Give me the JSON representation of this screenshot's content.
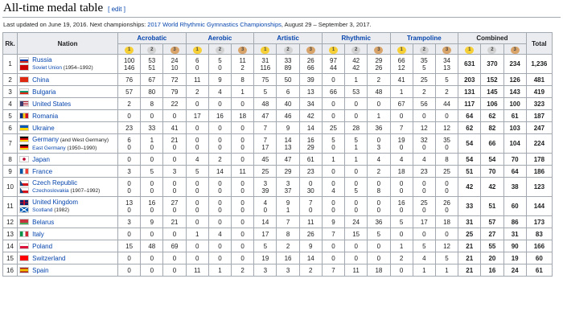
{
  "title": "All-time medal table",
  "edit": "[ edit ]",
  "updated": {
    "prefix": "Last updated on June 19, 2016. Next championships: ",
    "link": "2017 World Rhythmic Gymnastics Championships",
    "suffix": ", August 29 – September 3, 2017."
  },
  "headers": {
    "rk": "Rk.",
    "nation": "Nation",
    "sports": [
      "Acrobatic",
      "Aerobic",
      "Artistic",
      "Rhythmic",
      "Trampoline"
    ],
    "combined": "Combined",
    "total": "Total",
    "medals": [
      "1",
      "2",
      "3"
    ]
  },
  "rows": [
    {
      "rk": "1",
      "nations": [
        {
          "name": "Russia",
          "flag": "russia",
          "sub": false,
          "extra": ""
        },
        {
          "name": "Soviet Union",
          "flag": "ussr",
          "sub": true,
          "extra": " (1954–1992)"
        }
      ],
      "sports": [
        [
          "100",
          "146"
        ],
        [
          "53",
          "51"
        ],
        [
          "24",
          "10"
        ],
        [
          "6",
          "0"
        ],
        [
          "5",
          "0"
        ],
        [
          "11",
          "2"
        ],
        [
          "31",
          "116"
        ],
        [
          "33",
          "89"
        ],
        [
          "26",
          "66"
        ],
        [
          "97",
          "44"
        ],
        [
          "42",
          "42"
        ],
        [
          "29",
          "26"
        ],
        [
          "66",
          "12"
        ],
        [
          "35",
          "5"
        ],
        [
          "34",
          "13"
        ],
        [
          "9",
          "7"
        ]
      ],
      "combined": [
        "631",
        "370",
        "234"
      ],
      "total": "1,236"
    },
    {
      "rk": "2",
      "nations": [
        {
          "name": "China",
          "flag": "china",
          "sub": false,
          "extra": ""
        }
      ],
      "sports": [
        [
          "76"
        ],
        [
          "67"
        ],
        [
          "72"
        ],
        [
          "11"
        ],
        [
          "9"
        ],
        [
          "8"
        ],
        [
          "75"
        ],
        [
          "50"
        ],
        [
          "39"
        ],
        [
          "0"
        ],
        [
          "1"
        ],
        [
          "2"
        ],
        [
          "41"
        ],
        [
          "25"
        ],
        [
          "5"
        ]
      ],
      "combined": [
        "203",
        "152",
        "126"
      ],
      "total": "481"
    },
    {
      "rk": "3",
      "nations": [
        {
          "name": "Bulgaria",
          "flag": "bulgaria",
          "sub": false,
          "extra": ""
        }
      ],
      "sports": [
        [
          "57"
        ],
        [
          "80"
        ],
        [
          "79"
        ],
        [
          "2"
        ],
        [
          "4"
        ],
        [
          "1"
        ],
        [
          "5"
        ],
        [
          "6"
        ],
        [
          "13"
        ],
        [
          "66"
        ],
        [
          "53"
        ],
        [
          "48"
        ],
        [
          "1"
        ],
        [
          "2"
        ],
        [
          "2"
        ]
      ],
      "combined": [
        "131",
        "145",
        "143"
      ],
      "total": "419"
    },
    {
      "rk": "4",
      "nations": [
        {
          "name": "United States",
          "flag": "usa",
          "sub": false,
          "extra": ""
        }
      ],
      "sports": [
        [
          "2"
        ],
        [
          "8"
        ],
        [
          "22"
        ],
        [
          "0"
        ],
        [
          "0"
        ],
        [
          "0"
        ],
        [
          "48"
        ],
        [
          "40"
        ],
        [
          "34"
        ],
        [
          "0"
        ],
        [
          "0"
        ],
        [
          "0"
        ],
        [
          "67"
        ],
        [
          "56"
        ],
        [
          "44"
        ]
      ],
      "combined": [
        "117",
        "106",
        "100"
      ],
      "total": "323"
    },
    {
      "rk": "5",
      "nations": [
        {
          "name": "Romania",
          "flag": "romania",
          "sub": false,
          "extra": ""
        }
      ],
      "sports": [
        [
          "0"
        ],
        [
          "0"
        ],
        [
          "0"
        ],
        [
          "17"
        ],
        [
          "16"
        ],
        [
          "18"
        ],
        [
          "47"
        ],
        [
          "46"
        ],
        [
          "42"
        ],
        [
          "0"
        ],
        [
          "0"
        ],
        [
          "1"
        ],
        [
          "0"
        ],
        [
          "0"
        ],
        [
          "0"
        ]
      ],
      "combined": [
        "64",
        "62",
        "61"
      ],
      "total": "187"
    },
    {
      "rk": "6",
      "nations": [
        {
          "name": "Ukraine",
          "flag": "ukraine",
          "sub": false,
          "extra": ""
        }
      ],
      "sports": [
        [
          "23"
        ],
        [
          "33"
        ],
        [
          "41"
        ],
        [
          "0"
        ],
        [
          "0"
        ],
        [
          "0"
        ],
        [
          "7"
        ],
        [
          "9"
        ],
        [
          "14"
        ],
        [
          "25"
        ],
        [
          "28"
        ],
        [
          "36"
        ],
        [
          "7"
        ],
        [
          "12"
        ],
        [
          "12"
        ]
      ],
      "combined": [
        "62",
        "82",
        "103"
      ],
      "total": "247"
    },
    {
      "rk": "7",
      "nations": [
        {
          "name": "Germany",
          "flag": "germany",
          "sub": false,
          "extra": " (and West Germany)"
        },
        {
          "name": "East Germany",
          "flag": "gdr",
          "sub": true,
          "extra": " (1950–1990)"
        }
      ],
      "sports": [
        [
          "6",
          "0"
        ],
        [
          "1",
          "0"
        ],
        [
          "21",
          "0"
        ],
        [
          "0",
          "0"
        ],
        [
          "0",
          "0"
        ],
        [
          "0",
          "0"
        ],
        [
          "7",
          "17"
        ],
        [
          "14",
          "13"
        ],
        [
          "16",
          "29"
        ],
        [
          "5",
          "0"
        ],
        [
          "5",
          "1"
        ],
        [
          "0",
          "3"
        ],
        [
          "19",
          "0"
        ],
        [
          "32",
          "0"
        ],
        [
          "35",
          "0"
        ]
      ],
      "combined": [
        "54",
        "66",
        "104"
      ],
      "total": "224"
    },
    {
      "rk": "8",
      "nations": [
        {
          "name": "Japan",
          "flag": "japan",
          "sub": false,
          "extra": ""
        }
      ],
      "sports": [
        [
          "0"
        ],
        [
          "0"
        ],
        [
          "0"
        ],
        [
          "4"
        ],
        [
          "2"
        ],
        [
          "0"
        ],
        [
          "45"
        ],
        [
          "47"
        ],
        [
          "61"
        ],
        [
          "1"
        ],
        [
          "1"
        ],
        [
          "4"
        ],
        [
          "4"
        ],
        [
          "4"
        ],
        [
          "8"
        ]
      ],
      "combined": [
        "54",
        "54",
        "70"
      ],
      "total": "178"
    },
    {
      "rk": "9",
      "nations": [
        {
          "name": "France",
          "flag": "france",
          "sub": false,
          "extra": ""
        }
      ],
      "sports": [
        [
          "3"
        ],
        [
          "5"
        ],
        [
          "3"
        ],
        [
          "5"
        ],
        [
          "14"
        ],
        [
          "11"
        ],
        [
          "25"
        ],
        [
          "29"
        ],
        [
          "23"
        ],
        [
          "0"
        ],
        [
          "0"
        ],
        [
          "2"
        ],
        [
          "18"
        ],
        [
          "23"
        ],
        [
          "25"
        ]
      ],
      "combined": [
        "51",
        "70",
        "64"
      ],
      "total": "186"
    },
    {
      "rk": "10",
      "nations": [
        {
          "name": "Czech Republic",
          "flag": "czech",
          "sub": false,
          "extra": ""
        },
        {
          "name": "Czechoslovakia",
          "flag": "czech",
          "sub": true,
          "extra": " (1907–1992)"
        }
      ],
      "sports": [
        [
          "0",
          "0"
        ],
        [
          "0",
          "0"
        ],
        [
          "0",
          "0"
        ],
        [
          "0",
          "0"
        ],
        [
          "0",
          "0"
        ],
        [
          "0",
          "0"
        ],
        [
          "3",
          "39"
        ],
        [
          "3",
          "37"
        ],
        [
          "0",
          "30"
        ],
        [
          "0",
          "4"
        ],
        [
          "0",
          "5"
        ],
        [
          "0",
          "8"
        ],
        [
          "0",
          "0"
        ],
        [
          "0",
          "0"
        ],
        [
          "0",
          "0"
        ]
      ],
      "combined": [
        "42",
        "42",
        "38"
      ],
      "total": "123"
    },
    {
      "rk": "11",
      "nations": [
        {
          "name": "United Kingdom",
          "flag": "uk",
          "sub": false,
          "extra": ""
        },
        {
          "name": "Scotland",
          "flag": "scotland",
          "sub": true,
          "extra": " (1982)"
        }
      ],
      "sports": [
        [
          "13",
          "0"
        ],
        [
          "16",
          "0"
        ],
        [
          "27",
          "0"
        ],
        [
          "0",
          "0"
        ],
        [
          "0",
          "0"
        ],
        [
          "0",
          "0"
        ],
        [
          "4",
          "0"
        ],
        [
          "9",
          "1"
        ],
        [
          "7",
          "0"
        ],
        [
          "0",
          "0"
        ],
        [
          "0",
          "0"
        ],
        [
          "0",
          "0"
        ],
        [
          "16",
          "0"
        ],
        [
          "25",
          "0"
        ],
        [
          "26",
          "0"
        ]
      ],
      "combined": [
        "33",
        "51",
        "60"
      ],
      "total": "144"
    },
    {
      "rk": "12",
      "nations": [
        {
          "name": "Belarus",
          "flag": "belarus",
          "sub": false,
          "extra": ""
        }
      ],
      "sports": [
        [
          "3"
        ],
        [
          "9"
        ],
        [
          "21"
        ],
        [
          "0"
        ],
        [
          "0"
        ],
        [
          "0"
        ],
        [
          "14"
        ],
        [
          "7"
        ],
        [
          "11"
        ],
        [
          "9"
        ],
        [
          "24"
        ],
        [
          "36"
        ],
        [
          "5"
        ],
        [
          "17"
        ],
        [
          "18"
        ]
      ],
      "combined": [
        "31",
        "57",
        "86"
      ],
      "total": "173"
    },
    {
      "rk": "13",
      "nations": [
        {
          "name": "Italy",
          "flag": "italy",
          "sub": false,
          "extra": ""
        }
      ],
      "sports": [
        [
          "0"
        ],
        [
          "0"
        ],
        [
          "0"
        ],
        [
          "1"
        ],
        [
          "4"
        ],
        [
          "0"
        ],
        [
          "17"
        ],
        [
          "8"
        ],
        [
          "26"
        ],
        [
          "7"
        ],
        [
          "15"
        ],
        [
          "5"
        ],
        [
          "0"
        ],
        [
          "0"
        ],
        [
          "0"
        ]
      ],
      "combined": [
        "25",
        "27",
        "31"
      ],
      "total": "83"
    },
    {
      "rk": "14",
      "nations": [
        {
          "name": "Poland",
          "flag": "poland",
          "sub": false,
          "extra": ""
        }
      ],
      "sports": [
        [
          "15"
        ],
        [
          "48"
        ],
        [
          "69"
        ],
        [
          "0"
        ],
        [
          "0"
        ],
        [
          "0"
        ],
        [
          "5"
        ],
        [
          "2"
        ],
        [
          "9"
        ],
        [
          "0"
        ],
        [
          "0"
        ],
        [
          "0"
        ],
        [
          "1"
        ],
        [
          "5"
        ],
        [
          "12"
        ]
      ],
      "combined": [
        "21",
        "55",
        "90"
      ],
      "total": "166"
    },
    {
      "rk": "15",
      "nations": [
        {
          "name": "Switzerland",
          "flag": "switzerland",
          "sub": false,
          "extra": ""
        }
      ],
      "sports": [
        [
          "0"
        ],
        [
          "0"
        ],
        [
          "0"
        ],
        [
          "0"
        ],
        [
          "0"
        ],
        [
          "0"
        ],
        [
          "19"
        ],
        [
          "16"
        ],
        [
          "14"
        ],
        [
          "0"
        ],
        [
          "0"
        ],
        [
          "0"
        ],
        [
          "2"
        ],
        [
          "4"
        ],
        [
          "5"
        ]
      ],
      "combined": [
        "21",
        "20",
        "19"
      ],
      "total": "60"
    },
    {
      "rk": "16",
      "nations": [
        {
          "name": "Spain",
          "flag": "spain",
          "sub": false,
          "extra": ""
        }
      ],
      "sports": [
        [
          "0"
        ],
        [
          "0"
        ],
        [
          "0"
        ],
        [
          "11"
        ],
        [
          "1"
        ],
        [
          "2"
        ],
        [
          "3"
        ],
        [
          "3"
        ],
        [
          "2"
        ],
        [
          "7"
        ],
        [
          "11"
        ],
        [
          "18"
        ],
        [
          "0"
        ],
        [
          "1"
        ],
        [
          "1"
        ]
      ],
      "combined": [
        "21",
        "16",
        "24"
      ],
      "total": "61"
    }
  ],
  "flags": {
    "russia": [
      "#ffffff",
      "#0039a6",
      "#d52b1e"
    ],
    "ussr": [
      "#cc0000"
    ],
    "china": [
      "#de2910"
    ],
    "bulgaria": [
      "#ffffff",
      "#00966e",
      "#d62612"
    ],
    "usa": [
      "#b22234",
      "#ffffff",
      "#3c3b6e"
    ],
    "romania": [
      "#002b7f",
      "#fcd116",
      "#ce1126"
    ],
    "ukraine": [
      "#0057b7",
      "#ffd700"
    ],
    "germany": [
      "#000000",
      "#dd0000",
      "#ffce00"
    ],
    "gdr": [
      "#000000",
      "#dd0000",
      "#ffce00"
    ],
    "japan": [
      "#ffffff",
      "#bc002d"
    ],
    "france": [
      "#0055a4",
      "#ffffff",
      "#ef4135"
    ],
    "czech": [
      "#ffffff",
      "#d7141a",
      "#11457e"
    ],
    "uk": [
      "#012169",
      "#ffffff",
      "#c8102e"
    ],
    "scotland": [
      "#005eb8",
      "#ffffff"
    ],
    "belarus": [
      "#c8313e",
      "#4aa657"
    ],
    "italy": [
      "#009246",
      "#ffffff",
      "#ce2b37"
    ],
    "poland": [
      "#ffffff",
      "#dc143c"
    ],
    "switzerland": [
      "#ff0000",
      "#ffffff"
    ],
    "spain": [
      "#aa151b",
      "#f1bf00",
      "#aa151b"
    ]
  }
}
